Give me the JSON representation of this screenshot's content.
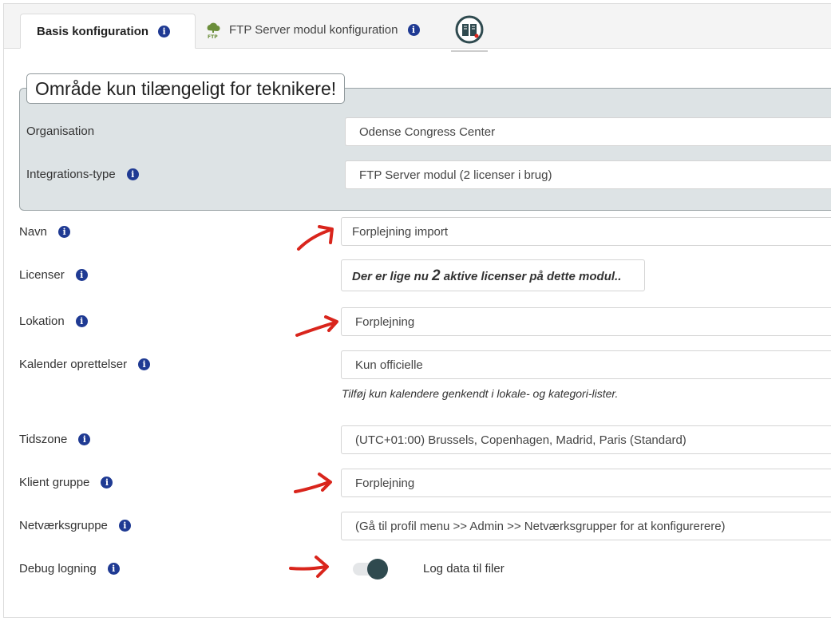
{
  "tabs": [
    {
      "label": "Basis konfiguration",
      "active": true
    },
    {
      "label": "FTP Server modul konfiguration",
      "active": false,
      "icon": "cloud-ftp-icon"
    },
    {
      "label": "",
      "icon": "book-icon"
    }
  ],
  "tech_section": {
    "legend": "Område kun tilængeligt for teknikere!",
    "organisation_label": "Organisation",
    "organisation_value": "Odense Congress Center",
    "integration_label": "Integrations-type",
    "integration_value": "FTP Server modul (2 licenser i brug)"
  },
  "form": {
    "navn_label": "Navn",
    "navn_value": "Forplejning import",
    "licenser_label": "Licenser",
    "licenser_text_pre": "Der er lige nu",
    "licenser_count": "2",
    "licenser_text_post": "aktive licenser på dette modul..",
    "lokation_label": "Lokation",
    "lokation_value": "Forplejning",
    "kalender_label": "Kalender oprettelser",
    "kalender_value": "Kun officielle",
    "kalender_hint": "Tilføj kun kalendere genkendt i lokale- og kategori-lister.",
    "tidszone_label": "Tidszone",
    "tidszone_value": "(UTC+01:00) Brussels, Copenhagen, Madrid, Paris (Standard)",
    "klient_label": "Klient gruppe",
    "klient_value": "Forplejning",
    "netvaerk_label": "Netværksgruppe",
    "netvaerk_value": "(Gå til profil menu >> Admin >> Netværksgrupper for at konfigurerere)",
    "debug_label": "Debug logning",
    "debug_on": true,
    "debug_toggle_text": "Log data til filer"
  },
  "info_glyph": "i",
  "colors": {
    "info_icon": "#1f3a93",
    "tech_bg": "#dde3e5",
    "annotation_arrow": "#d9251c",
    "toggle_knob": "#2f4a4f"
  }
}
